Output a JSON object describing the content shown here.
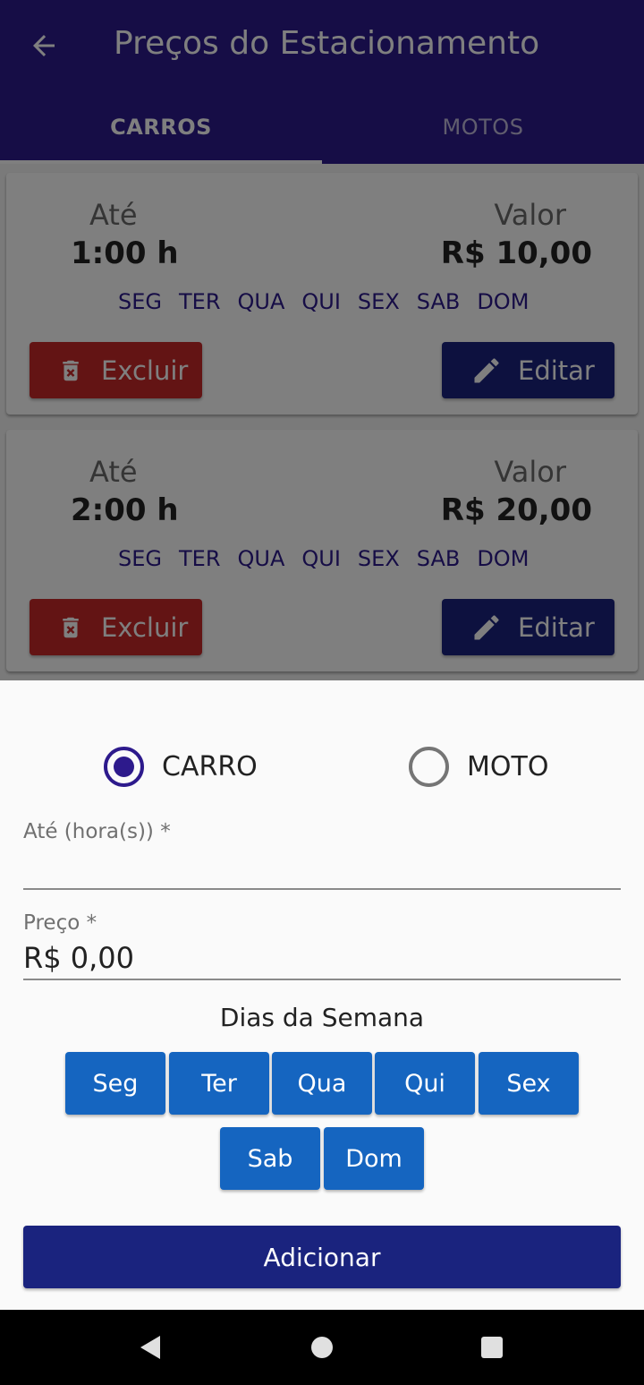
{
  "colors": {
    "appbar": "#2d1a8c",
    "danger": "#c62828",
    "primary_dark": "#1a237e",
    "chip": "#1565c0",
    "sheet_bg": "#fafafa"
  },
  "appbar": {
    "back_icon": "arrow-left-icon",
    "title": "Preços do Estacionamento",
    "tabs": [
      {
        "label": "CARROS",
        "selected": true
      },
      {
        "label": "MOTOS",
        "selected": false
      }
    ]
  },
  "cards": [
    {
      "until_label": "Até",
      "until_value": "1:00 h",
      "price_label": "Valor",
      "price_value": "R$ 10,00",
      "days": [
        "SEG",
        "TER",
        "QUA",
        "QUI",
        "SEX",
        "SAB",
        "DOM"
      ],
      "delete_label": "Excluir",
      "delete_icon": "trash-icon",
      "edit_label": "Editar",
      "edit_icon": "pencil-icon"
    },
    {
      "until_label": "Até",
      "until_value": "2:00 h",
      "price_label": "Valor",
      "price_value": "R$ 20,00",
      "days": [
        "SEG",
        "TER",
        "QUA",
        "QUI",
        "SEX",
        "SAB",
        "DOM"
      ],
      "delete_label": "Excluir",
      "delete_icon": "trash-icon",
      "edit_label": "Editar",
      "edit_icon": "pencil-icon"
    }
  ],
  "sheet": {
    "vehicle_options": [
      {
        "label": "CARRO",
        "selected": true
      },
      {
        "label": "MOTO",
        "selected": false
      }
    ],
    "until_field": {
      "label": "Até (hora(s)) *",
      "value": ""
    },
    "price_field": {
      "label": "Preço *",
      "value": "R$ 0,00"
    },
    "days_title": "Dias da Semana",
    "day_chips": [
      "Seg",
      "Ter",
      "Qua",
      "Qui",
      "Sex",
      "Sab",
      "Dom"
    ],
    "add_label": "Adicionar"
  },
  "navbar": {
    "back_icon": "triangle-back-icon",
    "home_icon": "circle-home-icon",
    "recents_icon": "square-recents-icon"
  }
}
